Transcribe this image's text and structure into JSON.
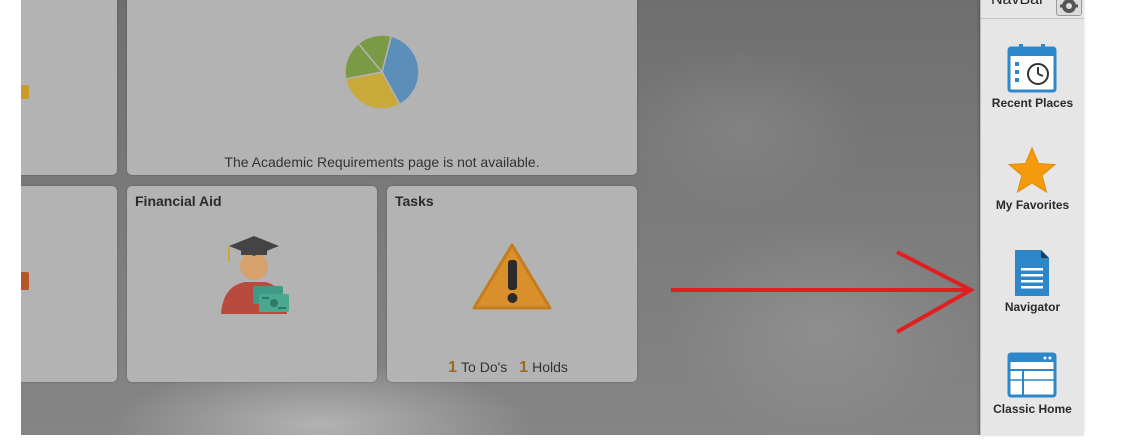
{
  "tiles": {
    "academic": {
      "unavailable_text": "The Academic Requirements page is not available."
    },
    "financial_aid": {
      "title": "Financial Aid",
      "icon": "graduate-money-icon"
    },
    "tasks": {
      "title": "Tasks",
      "icon": "warning-icon",
      "todos_count": "1",
      "todos_label": "To Do's",
      "holds_count": "1",
      "holds_label": "Holds"
    }
  },
  "pie": {
    "chart_data": {
      "type": "pie",
      "values": [
        38,
        30,
        17,
        15
      ],
      "colors": [
        "#5b8fb9",
        "#c8a93a",
        "#7a9a45",
        "#7a9a45"
      ]
    }
  },
  "navbar": {
    "title": "NavBar",
    "items": [
      {
        "label": "Recent Places",
        "icon": "calendar-clock-icon"
      },
      {
        "label": "My Favorites",
        "icon": "star-icon"
      },
      {
        "label": "Navigator",
        "icon": "document-icon"
      },
      {
        "label": "Classic Home",
        "icon": "browser-window-icon"
      }
    ]
  },
  "colors": {
    "arrow": "#e02020",
    "navbar_bg": "#e6e6e6",
    "tile_bg": "#b3b3b3",
    "icon_blue": "#2d87c9",
    "star": "#f59a0c"
  }
}
